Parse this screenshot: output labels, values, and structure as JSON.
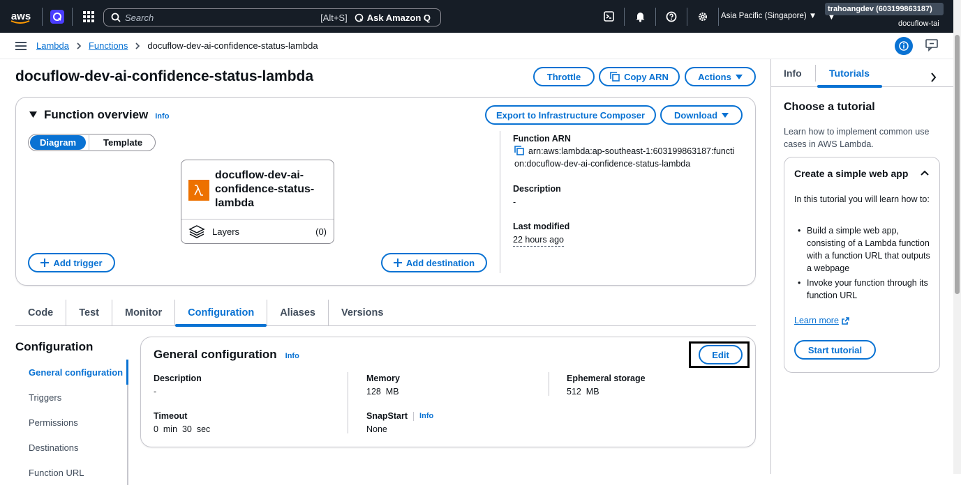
{
  "topnav": {
    "logo": "aws",
    "search_placeholder": "Search",
    "search_hotkey": "[Alt+S]",
    "ask_q": "Ask Amazon Q",
    "region": "Asia Pacific (Singapore) ▼",
    "account": "trahoangdev (603199863187) ▼",
    "account_alias": "docuflow-tai"
  },
  "breadcrumb": {
    "items": [
      "Lambda",
      "Functions"
    ],
    "current": "docuflow-dev-ai-confidence-status-lambda"
  },
  "page": {
    "title": "docuflow-dev-ai-confidence-status-lambda",
    "throttle": "Throttle",
    "copy_arn": "Copy ARN",
    "actions": "Actions"
  },
  "overview": {
    "title": "Function overview",
    "info": "Info",
    "export": "Export to Infrastructure Composer",
    "download": "Download",
    "seg_diagram": "Diagram",
    "seg_template": "Template",
    "fn_name": "docuflow-dev-ai-confidence-status-lambda",
    "layers": "Layers",
    "layers_count": "(0)",
    "add_trigger": "Add trigger",
    "add_destination": "Add destination",
    "arn_label": "Function ARN",
    "arn_value": "arn:aws:lambda:ap-southeast-1:603199863187:function:docuflow-dev-ai-confidence-status-lambda",
    "desc_label": "Description",
    "desc_value": "-",
    "modified_label": "Last modified",
    "modified_value": "22 hours ago"
  },
  "tabs": [
    "Code",
    "Test",
    "Monitor",
    "Configuration",
    "Aliases",
    "Versions"
  ],
  "config_nav": {
    "title": "Configuration",
    "items": [
      "General configuration",
      "Triggers",
      "Permissions",
      "Destinations",
      "Function URL"
    ]
  },
  "general": {
    "title": "General configuration",
    "info": "Info",
    "edit": "Edit",
    "description_label": "Description",
    "description_value": "-",
    "memory_label": "Memory",
    "memory_value": "128  MB",
    "ephemeral_label": "Ephemeral storage",
    "ephemeral_value": "512  MB",
    "timeout_label": "Timeout",
    "timeout_value": "0  min  30  sec",
    "snapstart_label": "SnapStart",
    "snapstart_info": "Info",
    "snapstart_value": "None"
  },
  "side": {
    "tab_info": "Info",
    "tab_tutorials": "Tutorials",
    "heading": "Choose a tutorial",
    "intro": "Learn how to implement common use cases in AWS Lambda.",
    "tut_title": "Create a simple web app",
    "tut_body": "In this tutorial you will learn how to:",
    "tut_bullets": [
      "Build a simple web app, consisting of a Lambda function with a function URL that outputs a webpage",
      "Invoke your function through its function URL"
    ],
    "learn_more": "Learn more",
    "start": "Start tutorial"
  },
  "colors": {
    "nav_bg": "#161d26",
    "accent": "#0972d3",
    "lambda_orange": "#ed7100"
  }
}
